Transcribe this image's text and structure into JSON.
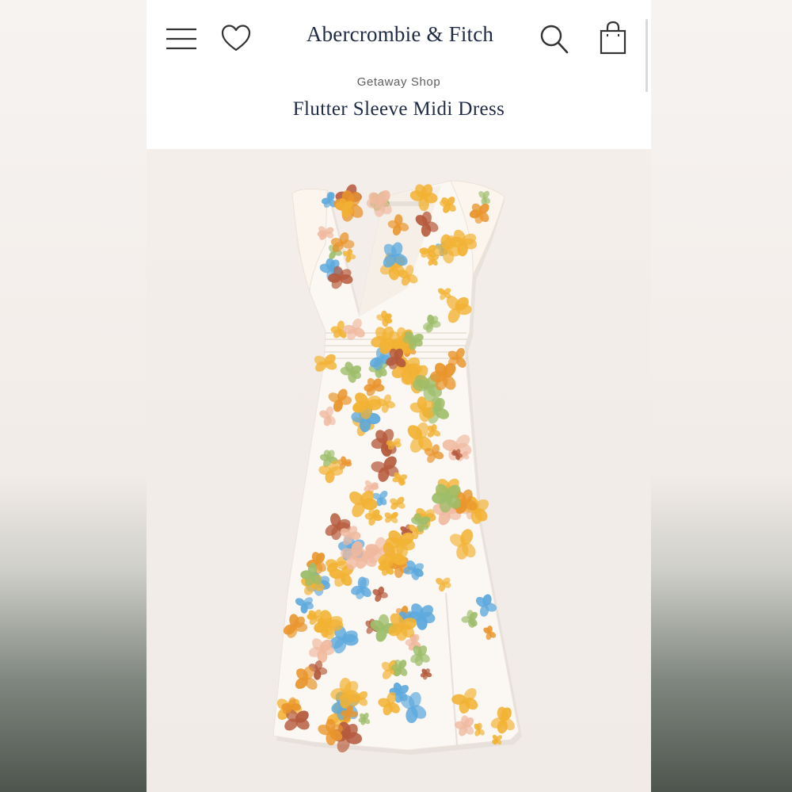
{
  "header": {
    "brand": "Abercrombie & Fitch",
    "menu_icon": "hamburger-menu-icon",
    "wishlist_icon": "heart-icon",
    "search_icon": "search-icon",
    "bag_icon": "shopping-bag-icon"
  },
  "product": {
    "collection": "Getaway Shop",
    "name": "Flutter Sleeve Midi Dress"
  },
  "image": {
    "subject": "floral-midi-dress",
    "palette": {
      "fabric": "#fbf7f2",
      "gold": "#f2b233",
      "orange": "#e9952c",
      "rust": "#b5593b",
      "peach": "#f0b99f",
      "blue": "#5da9dd",
      "green": "#9dbd6a"
    }
  },
  "colors": {
    "text_dark": "#1f2a44",
    "text_muted": "#5e5e5e"
  }
}
